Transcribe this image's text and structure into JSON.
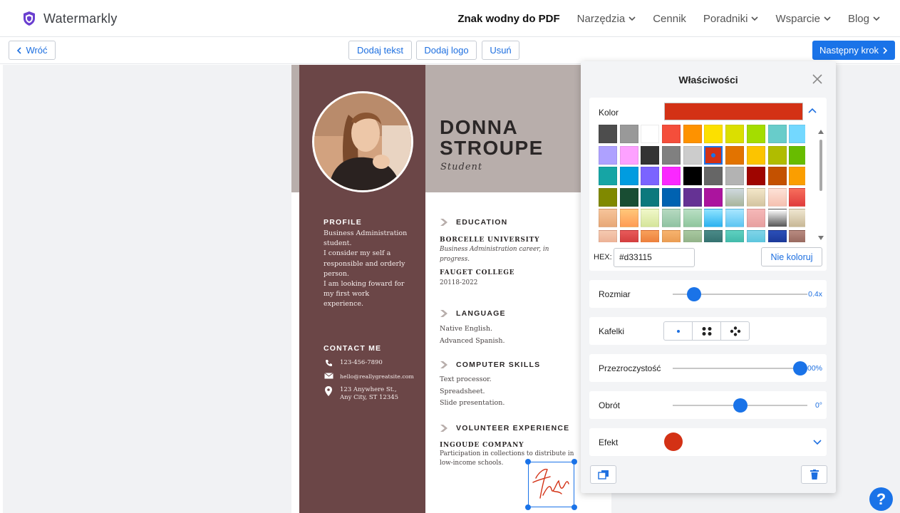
{
  "app": {
    "name": "Watermarkly",
    "accent": "#1a73e8"
  },
  "nav": {
    "items": [
      {
        "label": "Znak wodny do PDF",
        "active": true,
        "dropdown": false
      },
      {
        "label": "Narzędzia",
        "active": false,
        "dropdown": true
      },
      {
        "label": "Cennik",
        "active": false,
        "dropdown": false
      },
      {
        "label": "Poradniki",
        "active": false,
        "dropdown": true
      },
      {
        "label": "Wsparcie",
        "active": false,
        "dropdown": true
      },
      {
        "label": "Blog",
        "active": false,
        "dropdown": true
      }
    ]
  },
  "toolbar": {
    "back_label": "Wróć",
    "add_text_label": "Dodaj tekst",
    "add_logo_label": "Dodaj logo",
    "remove_label": "Usuń",
    "next_label": "Następny krok"
  },
  "resume": {
    "name_line1": "DONNA",
    "name_line2": "STROUPE",
    "role": "Student",
    "profile_heading": "PROFILE",
    "profile_lines": [
      "Business Administration",
      "student.",
      "I consider my self a",
      "responsible and orderly",
      "person.",
      "I am looking foward for",
      "my first work",
      "experience."
    ],
    "contact_heading": "CONTACT ME",
    "phone": "123-456-7890",
    "email": "hello@reallygreatsite.com",
    "address_line1": "123 Anywhere St.,",
    "address_line2": "Any City, ST 12345",
    "education_heading": "EDUCATION",
    "edu1_name": "BORCELLE UNIVERSITY",
    "edu1_desc_line1": "Business Administration career, in",
    "edu1_desc_line2": "progress.",
    "edu2_name": "FAUGET COLLEGE",
    "edu2_years": "20118-2022",
    "language_heading": "LANGUAGE",
    "lang_lines": [
      "Native English.",
      "Advanced Spanish."
    ],
    "skills_heading": "COMPUTER SKILLS",
    "skills_lines": [
      "Text processor.",
      "Spreadsheet.",
      "Slide presentation."
    ],
    "volunteer_heading": "VOLUNTEER EXPERIENCE",
    "vol_company": "INGOUDE COMPANY",
    "vol_desc_line1": "Participation in collections to distribute in",
    "vol_desc_line2": "low-income schools.",
    "colors": {
      "sidebar": "#6b4647",
      "topband": "#b8aeab",
      "signature": "#d33115"
    }
  },
  "panel": {
    "title": "Właściwości",
    "color_label": "Kolor",
    "current_color": "#d33115",
    "hex_label": "HEX:",
    "hex_value": "#d33115",
    "no_color_label": "Nie koloruj",
    "size_label": "Rozmiar",
    "size_value": "0.4x",
    "size_fraction": 0.16,
    "tiles_label": "Kafelki",
    "opacity_label": "Przezroczystość",
    "opacity_value": "100%",
    "opacity_fraction": 1.0,
    "rotation_label": "Obrót",
    "rotation_value": "0°",
    "rotation_fraction": 0.5,
    "effect_label": "Efekt",
    "swatches": [
      "#4d4d4d",
      "#999999",
      "#ffffff",
      "#f44e3b",
      "#fe9200",
      "#fce000",
      "#dbdf00",
      "#a4dd00",
      "#68ccca",
      "#73d8ff",
      "#aea1ff",
      "#fda1ff",
      "#333333",
      "#808080",
      "#cccccc",
      "#d33115",
      "#e27300",
      "#fcc400",
      "#b0bc00",
      "#68bc00",
      "#16a5a5",
      "#009ce0",
      "#7b64ff",
      "#fa28ff",
      "#000000",
      "#666666",
      "#b3b3b3",
      "#9f0500",
      "#c45100",
      "#fb9e00",
      "#808900",
      "#194d33",
      "#0c797d",
      "#0062b1",
      "#653294",
      "#ab149e",
      "linear-gradient(#cfd9df,#a8b59b)",
      "linear-gradient(#f3e7c9,#d4c4a0)",
      "linear-gradient(#fde2d7,#f5c0b0)",
      "linear-gradient(#f66e5c,#e03c3c)",
      "linear-gradient(#f6c49a,#e8a877)",
      "linear-gradient(#ffc77a,#ff9c55)",
      "linear-gradient(#f0f7c9,#d5e59a)",
      "linear-gradient(#b6d9c0,#8fc3a2)",
      "linear-gradient(#b9dfc4,#8fc69e)",
      "linear-gradient(#8fe3ff,#2bb2f0)",
      "linear-gradient(#a8e6ff,#5cc5f2)",
      "linear-gradient(#f5b8b8,#e8a0a0)",
      "linear-gradient(#ffffff,#555555)",
      "linear-gradient(#efe6d0,#c8b896)",
      "linear-gradient(#f5c9b0,#e8a78a)",
      "linear-gradient(#e85a5a,#c93030)",
      "linear-gradient(#f8a05a,#e7702e)",
      "linear-gradient(#f7b36e,#e49145)",
      "linear-gradient(#a8c8a0,#86a87d)",
      "linear-gradient(#4a8a88,#2a6664)",
      "linear-gradient(#5ed0c0,#34b0a0)",
      "linear-gradient(#7fd4e8,#4cbfd8)",
      "linear-gradient(#2b4fb8,#142e8a)",
      "linear-gradient(#b88a80,#8a5a50)"
    ],
    "selected_swatch": 15
  },
  "help_label": "?"
}
